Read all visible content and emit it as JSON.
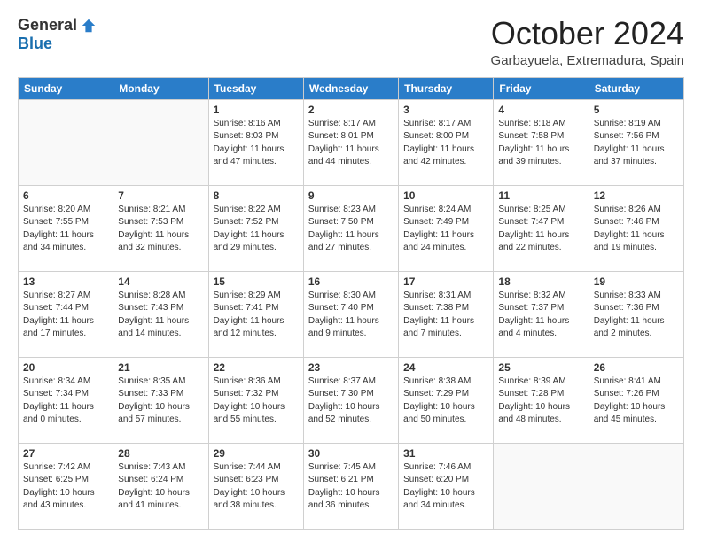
{
  "logo": {
    "general": "General",
    "blue": "Blue"
  },
  "title": "October 2024",
  "subtitle": "Garbayuela, Extremadura, Spain",
  "weekdays": [
    "Sunday",
    "Monday",
    "Tuesday",
    "Wednesday",
    "Thursday",
    "Friday",
    "Saturday"
  ],
  "weeks": [
    [
      {
        "day": "",
        "sunrise": "",
        "sunset": "",
        "daylight": ""
      },
      {
        "day": "",
        "sunrise": "",
        "sunset": "",
        "daylight": ""
      },
      {
        "day": "1",
        "sunrise": "Sunrise: 8:16 AM",
        "sunset": "Sunset: 8:03 PM",
        "daylight": "Daylight: 11 hours and 47 minutes."
      },
      {
        "day": "2",
        "sunrise": "Sunrise: 8:17 AM",
        "sunset": "Sunset: 8:01 PM",
        "daylight": "Daylight: 11 hours and 44 minutes."
      },
      {
        "day": "3",
        "sunrise": "Sunrise: 8:17 AM",
        "sunset": "Sunset: 8:00 PM",
        "daylight": "Daylight: 11 hours and 42 minutes."
      },
      {
        "day": "4",
        "sunrise": "Sunrise: 8:18 AM",
        "sunset": "Sunset: 7:58 PM",
        "daylight": "Daylight: 11 hours and 39 minutes."
      },
      {
        "day": "5",
        "sunrise": "Sunrise: 8:19 AM",
        "sunset": "Sunset: 7:56 PM",
        "daylight": "Daylight: 11 hours and 37 minutes."
      }
    ],
    [
      {
        "day": "6",
        "sunrise": "Sunrise: 8:20 AM",
        "sunset": "Sunset: 7:55 PM",
        "daylight": "Daylight: 11 hours and 34 minutes."
      },
      {
        "day": "7",
        "sunrise": "Sunrise: 8:21 AM",
        "sunset": "Sunset: 7:53 PM",
        "daylight": "Daylight: 11 hours and 32 minutes."
      },
      {
        "day": "8",
        "sunrise": "Sunrise: 8:22 AM",
        "sunset": "Sunset: 7:52 PM",
        "daylight": "Daylight: 11 hours and 29 minutes."
      },
      {
        "day": "9",
        "sunrise": "Sunrise: 8:23 AM",
        "sunset": "Sunset: 7:50 PM",
        "daylight": "Daylight: 11 hours and 27 minutes."
      },
      {
        "day": "10",
        "sunrise": "Sunrise: 8:24 AM",
        "sunset": "Sunset: 7:49 PM",
        "daylight": "Daylight: 11 hours and 24 minutes."
      },
      {
        "day": "11",
        "sunrise": "Sunrise: 8:25 AM",
        "sunset": "Sunset: 7:47 PM",
        "daylight": "Daylight: 11 hours and 22 minutes."
      },
      {
        "day": "12",
        "sunrise": "Sunrise: 8:26 AM",
        "sunset": "Sunset: 7:46 PM",
        "daylight": "Daylight: 11 hours and 19 minutes."
      }
    ],
    [
      {
        "day": "13",
        "sunrise": "Sunrise: 8:27 AM",
        "sunset": "Sunset: 7:44 PM",
        "daylight": "Daylight: 11 hours and 17 minutes."
      },
      {
        "day": "14",
        "sunrise": "Sunrise: 8:28 AM",
        "sunset": "Sunset: 7:43 PM",
        "daylight": "Daylight: 11 hours and 14 minutes."
      },
      {
        "day": "15",
        "sunrise": "Sunrise: 8:29 AM",
        "sunset": "Sunset: 7:41 PM",
        "daylight": "Daylight: 11 hours and 12 minutes."
      },
      {
        "day": "16",
        "sunrise": "Sunrise: 8:30 AM",
        "sunset": "Sunset: 7:40 PM",
        "daylight": "Daylight: 11 hours and 9 minutes."
      },
      {
        "day": "17",
        "sunrise": "Sunrise: 8:31 AM",
        "sunset": "Sunset: 7:38 PM",
        "daylight": "Daylight: 11 hours and 7 minutes."
      },
      {
        "day": "18",
        "sunrise": "Sunrise: 8:32 AM",
        "sunset": "Sunset: 7:37 PM",
        "daylight": "Daylight: 11 hours and 4 minutes."
      },
      {
        "day": "19",
        "sunrise": "Sunrise: 8:33 AM",
        "sunset": "Sunset: 7:36 PM",
        "daylight": "Daylight: 11 hours and 2 minutes."
      }
    ],
    [
      {
        "day": "20",
        "sunrise": "Sunrise: 8:34 AM",
        "sunset": "Sunset: 7:34 PM",
        "daylight": "Daylight: 11 hours and 0 minutes."
      },
      {
        "day": "21",
        "sunrise": "Sunrise: 8:35 AM",
        "sunset": "Sunset: 7:33 PM",
        "daylight": "Daylight: 10 hours and 57 minutes."
      },
      {
        "day": "22",
        "sunrise": "Sunrise: 8:36 AM",
        "sunset": "Sunset: 7:32 PM",
        "daylight": "Daylight: 10 hours and 55 minutes."
      },
      {
        "day": "23",
        "sunrise": "Sunrise: 8:37 AM",
        "sunset": "Sunset: 7:30 PM",
        "daylight": "Daylight: 10 hours and 52 minutes."
      },
      {
        "day": "24",
        "sunrise": "Sunrise: 8:38 AM",
        "sunset": "Sunset: 7:29 PM",
        "daylight": "Daylight: 10 hours and 50 minutes."
      },
      {
        "day": "25",
        "sunrise": "Sunrise: 8:39 AM",
        "sunset": "Sunset: 7:28 PM",
        "daylight": "Daylight: 10 hours and 48 minutes."
      },
      {
        "day": "26",
        "sunrise": "Sunrise: 8:41 AM",
        "sunset": "Sunset: 7:26 PM",
        "daylight": "Daylight: 10 hours and 45 minutes."
      }
    ],
    [
      {
        "day": "27",
        "sunrise": "Sunrise: 7:42 AM",
        "sunset": "Sunset: 6:25 PM",
        "daylight": "Daylight: 10 hours and 43 minutes."
      },
      {
        "day": "28",
        "sunrise": "Sunrise: 7:43 AM",
        "sunset": "Sunset: 6:24 PM",
        "daylight": "Daylight: 10 hours and 41 minutes."
      },
      {
        "day": "29",
        "sunrise": "Sunrise: 7:44 AM",
        "sunset": "Sunset: 6:23 PM",
        "daylight": "Daylight: 10 hours and 38 minutes."
      },
      {
        "day": "30",
        "sunrise": "Sunrise: 7:45 AM",
        "sunset": "Sunset: 6:21 PM",
        "daylight": "Daylight: 10 hours and 36 minutes."
      },
      {
        "day": "31",
        "sunrise": "Sunrise: 7:46 AM",
        "sunset": "Sunset: 6:20 PM",
        "daylight": "Daylight: 10 hours and 34 minutes."
      },
      {
        "day": "",
        "sunrise": "",
        "sunset": "",
        "daylight": ""
      },
      {
        "day": "",
        "sunrise": "",
        "sunset": "",
        "daylight": ""
      }
    ]
  ]
}
